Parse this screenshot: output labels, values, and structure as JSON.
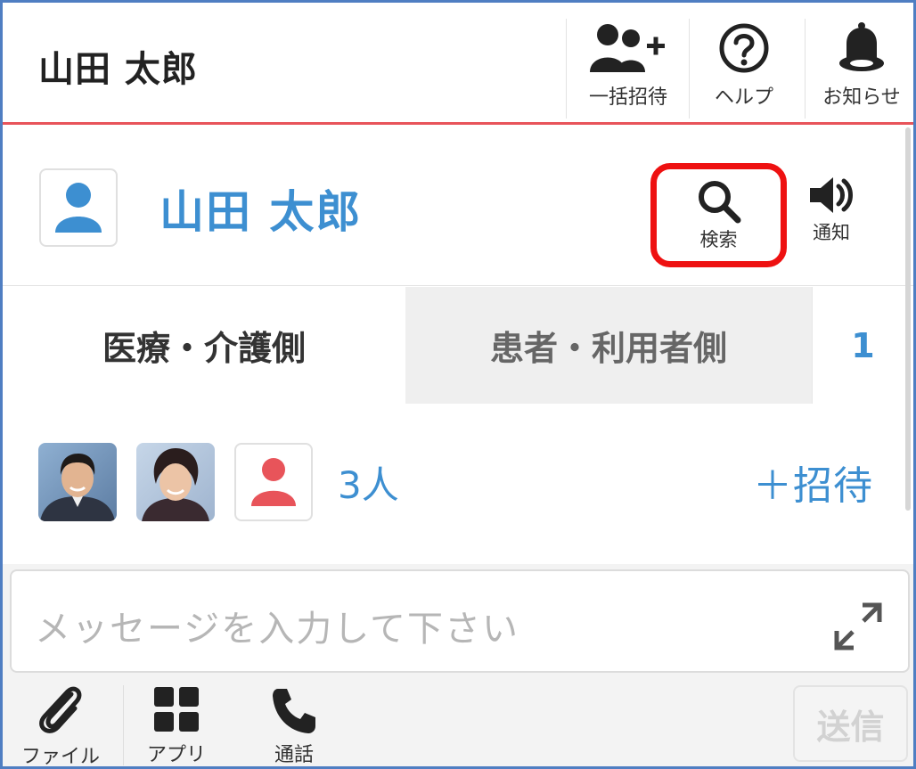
{
  "header": {
    "user_name": "山田 太郎",
    "nav": [
      {
        "label": "一括招待",
        "icon": "bulk-invite-icon"
      },
      {
        "label": "ヘルプ",
        "icon": "help-icon"
      },
      {
        "label": "お知らせ",
        "icon": "bell-icon"
      }
    ]
  },
  "profile": {
    "name": "山田 太郎",
    "search_label": "検索",
    "notify_label": "通知",
    "highlight_color": "#ee1111",
    "accent_color": "#3d8fd1"
  },
  "tabs": [
    {
      "label": "医療・介護側",
      "active": true
    },
    {
      "label": "患者・利用者側",
      "active": false
    },
    {
      "label": "1",
      "active": false
    }
  ],
  "members": {
    "count_label": "3人",
    "invite_label": "＋招待"
  },
  "composer": {
    "placeholder": "メッセージを入力して下さい",
    "tools": [
      {
        "label": "ファイル",
        "icon": "paperclip-icon"
      },
      {
        "label": "アプリ",
        "icon": "apps-grid-icon"
      },
      {
        "label": "通話",
        "icon": "phone-icon"
      }
    ],
    "send_label": "送信"
  }
}
